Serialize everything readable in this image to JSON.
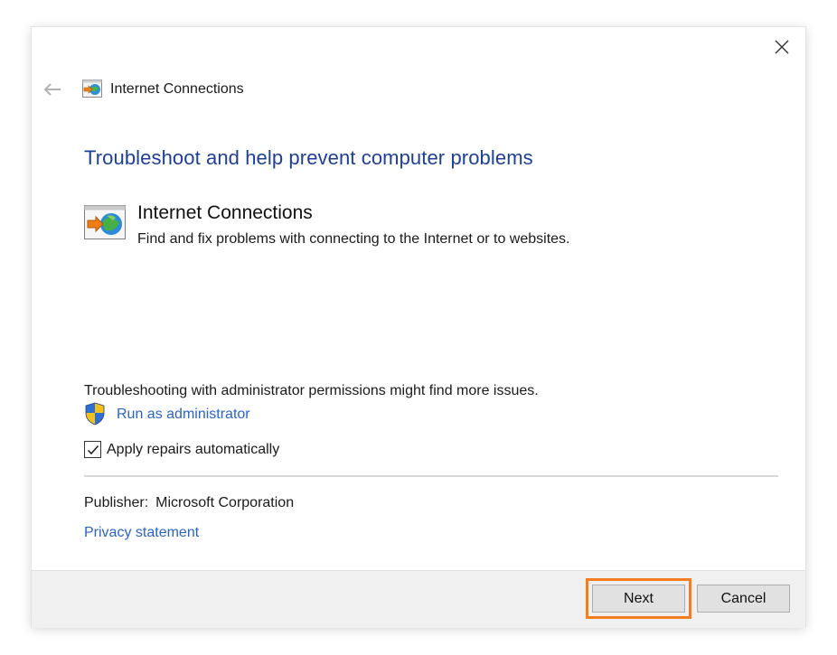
{
  "window": {
    "title": "Internet Connections",
    "close_icon": "close-icon",
    "back_icon": "back-arrow-icon"
  },
  "content": {
    "heading": "Troubleshoot and help prevent computer problems",
    "troubleshooter": {
      "name": "Internet Connections",
      "description": "Find and fix problems with connecting to the Internet or to websites.",
      "icon": "internet-connections-icon"
    },
    "admin_note": "Troubleshooting with administrator permissions might find more issues.",
    "run_as_admin": {
      "label": "Run as administrator",
      "icon": "uac-shield-icon"
    },
    "apply_repairs": {
      "label": "Apply repairs automatically",
      "checked": true
    },
    "publisher": {
      "label": "Publisher:",
      "value": "Microsoft Corporation"
    },
    "privacy_link": "Privacy statement"
  },
  "footer": {
    "next_label": "Next",
    "cancel_label": "Cancel"
  },
  "colors": {
    "heading": "#1e3f96",
    "link": "#2a64c4",
    "highlight": "#f57c1f",
    "footer_bg": "#f0f0f0"
  }
}
